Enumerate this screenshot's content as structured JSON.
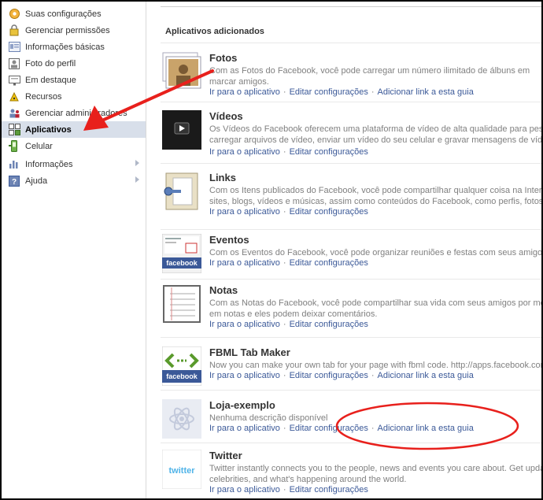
{
  "sidebar": {
    "items": [
      {
        "label": "Suas configurações",
        "icon": "settings-gear-icon"
      },
      {
        "label": "Gerenciar permissões",
        "icon": "lock-icon"
      },
      {
        "label": "Informações básicas",
        "icon": "info-card-icon"
      },
      {
        "label": "Foto do perfil",
        "icon": "profile-photo-icon"
      },
      {
        "label": "Em destaque",
        "icon": "featured-icon"
      },
      {
        "label": "Recursos",
        "icon": "resources-icon"
      },
      {
        "label": "Gerenciar administradores",
        "icon": "admins-icon"
      },
      {
        "label": "Aplicativos",
        "icon": "applications-icon"
      },
      {
        "label": "Celular",
        "icon": "mobile-icon"
      },
      {
        "label": "Informações",
        "icon": "insights-chart-icon"
      },
      {
        "label": "Ajuda",
        "icon": "help-icon"
      }
    ]
  },
  "main": {
    "section_title": "Aplicativos adicionados",
    "apps": [
      {
        "name": "Fotos",
        "desc1": "Com as Fotos do Facebook, você pode carregar um número ilimitado de álbuns em",
        "desc2": "marcar amigos.",
        "links": [
          "Ir para o aplicativo",
          "Editar configurações",
          "Adicionar link a esta guia"
        ]
      },
      {
        "name": "Vídeos",
        "desc1": "Os Vídeos do Facebook oferecem uma plataforma de vídeo de alta qualidade para pessoas",
        "desc2": "carregar arquivos de vídeo, enviar um vídeo do seu celular e gravar mensagens de vídeo",
        "links": [
          "Ir para o aplicativo",
          "Editar configurações"
        ]
      },
      {
        "name": "Links",
        "desc1": "Com os Itens publicados do Facebook, você pode compartilhar qualquer coisa na Internet",
        "desc2": "sites, blogs, vídeos e músicas, assim como conteúdos do Facebook, como perfis, fotos, not",
        "links": [
          "Ir para o aplicativo",
          "Editar configurações"
        ]
      },
      {
        "name": "Eventos",
        "desc1": "Com os Eventos do Facebook, você pode organizar reuniões e festas com seus amigos, ac",
        "desc2": "",
        "links": [
          "Ir para o aplicativo",
          "Editar configurações"
        ]
      },
      {
        "name": "Notas",
        "desc1": "Com as Notas do Facebook, você pode compartilhar sua vida com seus amigos por meio de",
        "desc2": "em notas e eles podem deixar comentários.",
        "links": [
          "Ir para o aplicativo",
          "Editar configurações"
        ]
      },
      {
        "name": "FBML Tab Maker",
        "desc1": "Now you can make your own tab for your page with fbml code. http://apps.facebook.com/",
        "desc2": "",
        "links": [
          "Ir para o aplicativo",
          "Editar configurações",
          "Adicionar link a esta guia"
        ]
      },
      {
        "name": "Loja-exemplo",
        "desc1": "Nenhuma descrição disponível",
        "desc2": "",
        "links": [
          "Ir para o aplicativo",
          "Editar configurações",
          "Adicionar link a esta guia"
        ]
      },
      {
        "name": "Twitter",
        "desc1": "Twitter instantly connects you to the people, news and events you care about. Get updat",
        "desc2": "celebrities, and what's happening around the world.",
        "links": [
          "Ir para o aplicativo",
          "Editar configurações"
        ]
      }
    ],
    "thumb_texts": {
      "facebook": "facebook",
      "twitter": "twitter"
    }
  },
  "colors": {
    "link": "#3b5998",
    "active_bg": "#d8dfea",
    "annotation_red": "#e8201c"
  }
}
